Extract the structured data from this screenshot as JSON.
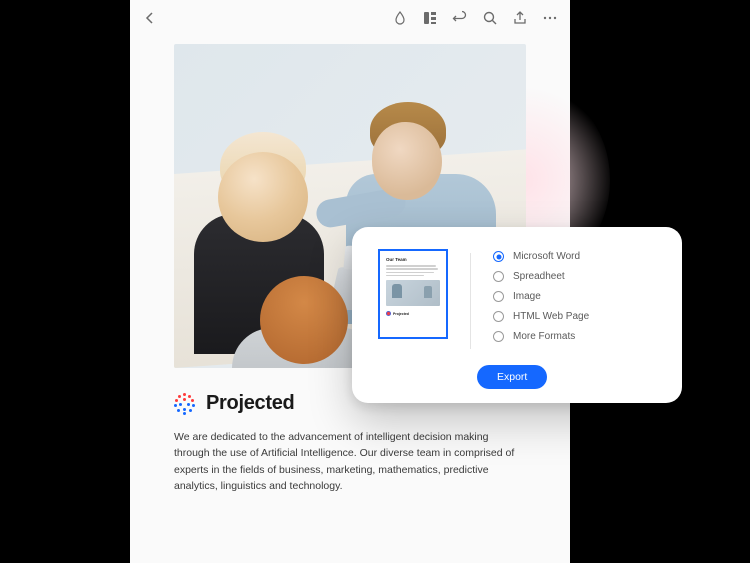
{
  "toolbar": {
    "icons": [
      "back-icon",
      "ink-icon",
      "panel-icon",
      "undo-icon",
      "search-icon",
      "share-icon",
      "more-icon"
    ]
  },
  "document": {
    "brand_name": "Projected",
    "body_text": "We are dedicated to the advancement of intelligent decision making through the use of Artificial Intelligence. Our diverse team in comprised of experts in the fields of business,  marketing, mathematics, predictive analytics, linguistics and technology."
  },
  "export_panel": {
    "thumb_title": "Our Team",
    "thumb_brand": "Projected",
    "options": [
      {
        "label": "Microsoft Word",
        "selected": true
      },
      {
        "label": "Spreadheet",
        "selected": false
      },
      {
        "label": "Image",
        "selected": false
      },
      {
        "label": "HTML Web Page",
        "selected": false
      },
      {
        "label": "More Formats",
        "selected": false
      }
    ],
    "export_label": "Export"
  }
}
